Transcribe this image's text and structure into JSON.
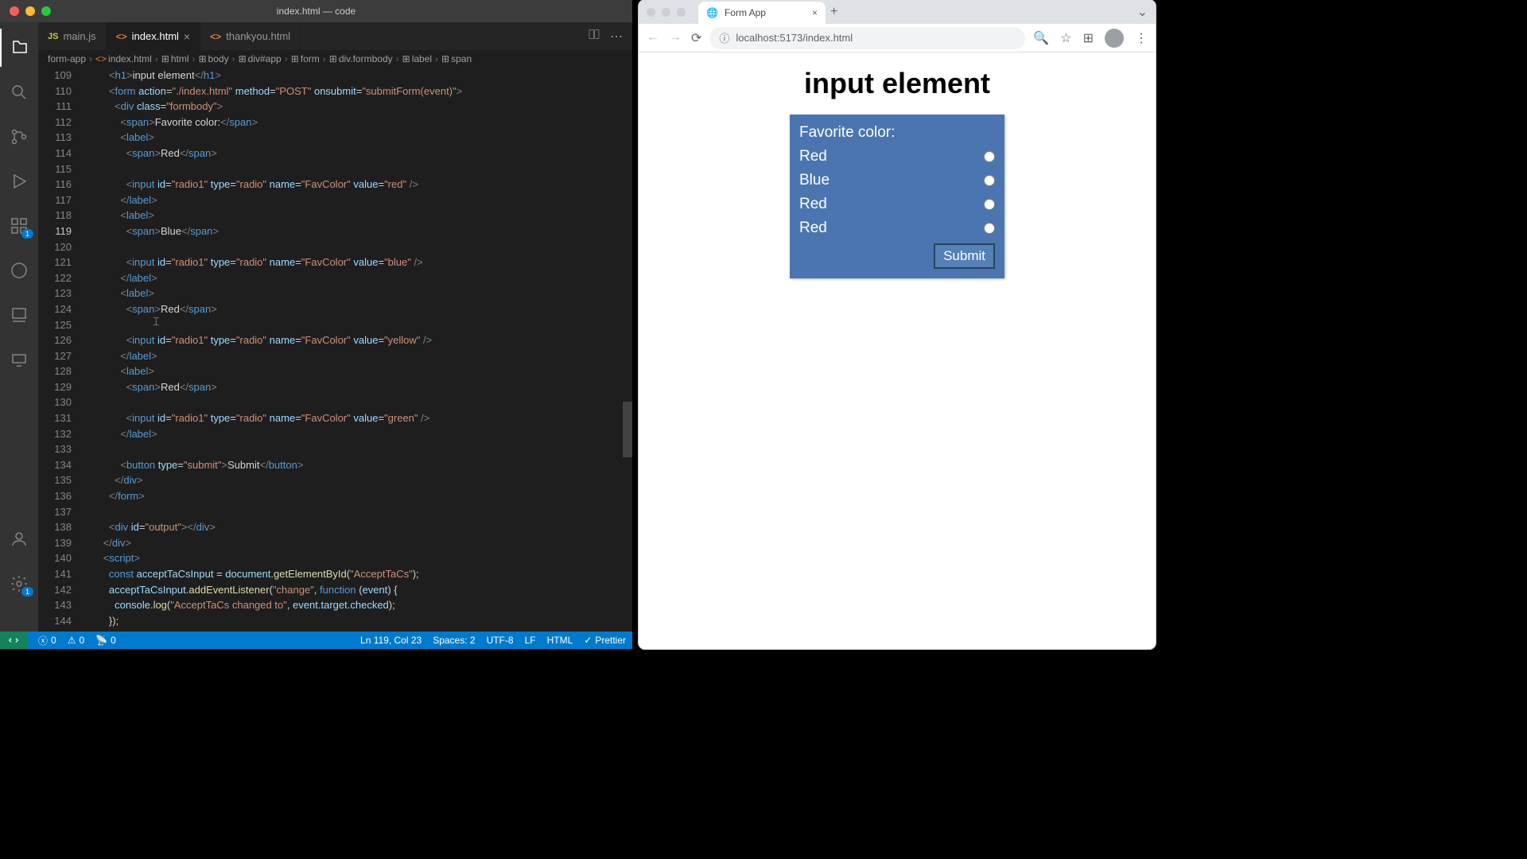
{
  "vscode": {
    "window_title": "index.html — code",
    "tabs": [
      {
        "icon": "JS",
        "label": "main.js",
        "active": false,
        "close": false
      },
      {
        "icon": "<>",
        "label": "index.html",
        "active": true,
        "close": true
      },
      {
        "icon": "<>",
        "label": "thankyou.html",
        "active": false,
        "close": false
      }
    ],
    "breadcrumb": [
      "form-app",
      "index.html",
      "html",
      "body",
      "div#app",
      "form",
      "div.formbody",
      "label",
      "span"
    ],
    "line_start": 109,
    "active_line": 119,
    "statusbar": {
      "errors": "0",
      "warnings": "0",
      "port": "0",
      "position": "Ln 119, Col 23",
      "spaces": "Spaces: 2",
      "encoding": "UTF-8",
      "eol": "LF",
      "lang": "HTML",
      "prettier": "Prettier"
    },
    "ext_badge": "1",
    "gear_badge": "1"
  },
  "browser": {
    "tab_title": "Form App",
    "url": "localhost:5173/index.html",
    "page": {
      "heading": "input element",
      "legend": "Favorite color:",
      "options": [
        "Red",
        "Blue",
        "Red",
        "Red"
      ],
      "submit": "Submit"
    }
  }
}
